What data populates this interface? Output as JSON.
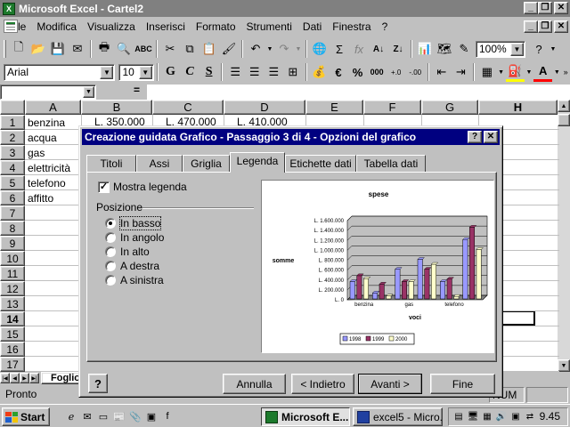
{
  "window": {
    "title": "Microsoft Excel - Cartel2"
  },
  "menu": [
    "File",
    "Modifica",
    "Visualizza",
    "Inserisci",
    "Formato",
    "Strumenti",
    "Dati",
    "Finestra",
    "?"
  ],
  "toolbar": {
    "zoom": "100%",
    "font": "Arial",
    "size": "10"
  },
  "formula": {
    "equals": "="
  },
  "sheet": {
    "columns": [
      "A",
      "B",
      "C",
      "D",
      "E",
      "F",
      "G",
      "H"
    ],
    "rows": [
      "1",
      "2",
      "3",
      "4",
      "5",
      "6",
      "7",
      "8",
      "9",
      "10",
      "11",
      "12",
      "13",
      "14",
      "15",
      "16",
      "17"
    ],
    "labels": [
      "benzina",
      "acqua",
      "gas",
      "elettricità",
      "telefono",
      "affitto"
    ],
    "row1_values": [
      "L. 350.000",
      "L. 470.000",
      "L. 410.000"
    ],
    "tab": "Foglio"
  },
  "status": {
    "left": "Pronto",
    "num": "NUM"
  },
  "taskbar": {
    "start": "Start",
    "items": [
      "Microsoft E...",
      "excel5 - Micro..."
    ],
    "clock": "9.45"
  },
  "dialog": {
    "title": "Creazione guidata Grafico - Passaggio 3 di 4 - Opzioni del grafico",
    "tabs": [
      "Titoli",
      "Assi",
      "Griglia",
      "Legenda",
      "Etichette dati",
      "Tabella dati"
    ],
    "active_tab": "Legenda",
    "show_legend": "Mostra legenda",
    "position_label": "Posizione",
    "positions": [
      "In basso",
      "In angolo",
      "In alto",
      "A destra",
      "A sinistra"
    ],
    "selected_position": "In basso",
    "buttons": {
      "cancel": "Annulla",
      "back": "< Indietro",
      "next": "Avanti >",
      "finish": "Fine"
    }
  },
  "chart_data": {
    "type": "bar",
    "title": "spese",
    "xlabel": "voci",
    "ylabel": "somme",
    "categories": [
      "benzina",
      "acqua",
      "gas",
      "elettricità",
      "telefono",
      "affitto"
    ],
    "visible_category_labels": [
      "benzina",
      "gas",
      "telefono"
    ],
    "ylim": [
      0,
      1600000
    ],
    "y_tick_labels": [
      "L. 1.600.000",
      "L. 1.400.000",
      "L. 1.200.000",
      "L. 1.000.000",
      "L. 800.000",
      "L. 600.000",
      "L. 400.000",
      "L. 200.000",
      "L. 0"
    ],
    "series": [
      {
        "name": "1998",
        "color": "#9999ff",
        "values": [
          350000,
          120000,
          600000,
          800000,
          350000,
          1200000
        ]
      },
      {
        "name": "1999",
        "color": "#993366",
        "values": [
          470000,
          300000,
          350000,
          600000,
          400000,
          1450000
        ]
      },
      {
        "name": "2000",
        "color": "#ffffcc",
        "values": [
          410000,
          60000,
          350000,
          700000,
          50000,
          1000000
        ]
      }
    ],
    "grid": true,
    "legend": "bottom"
  }
}
